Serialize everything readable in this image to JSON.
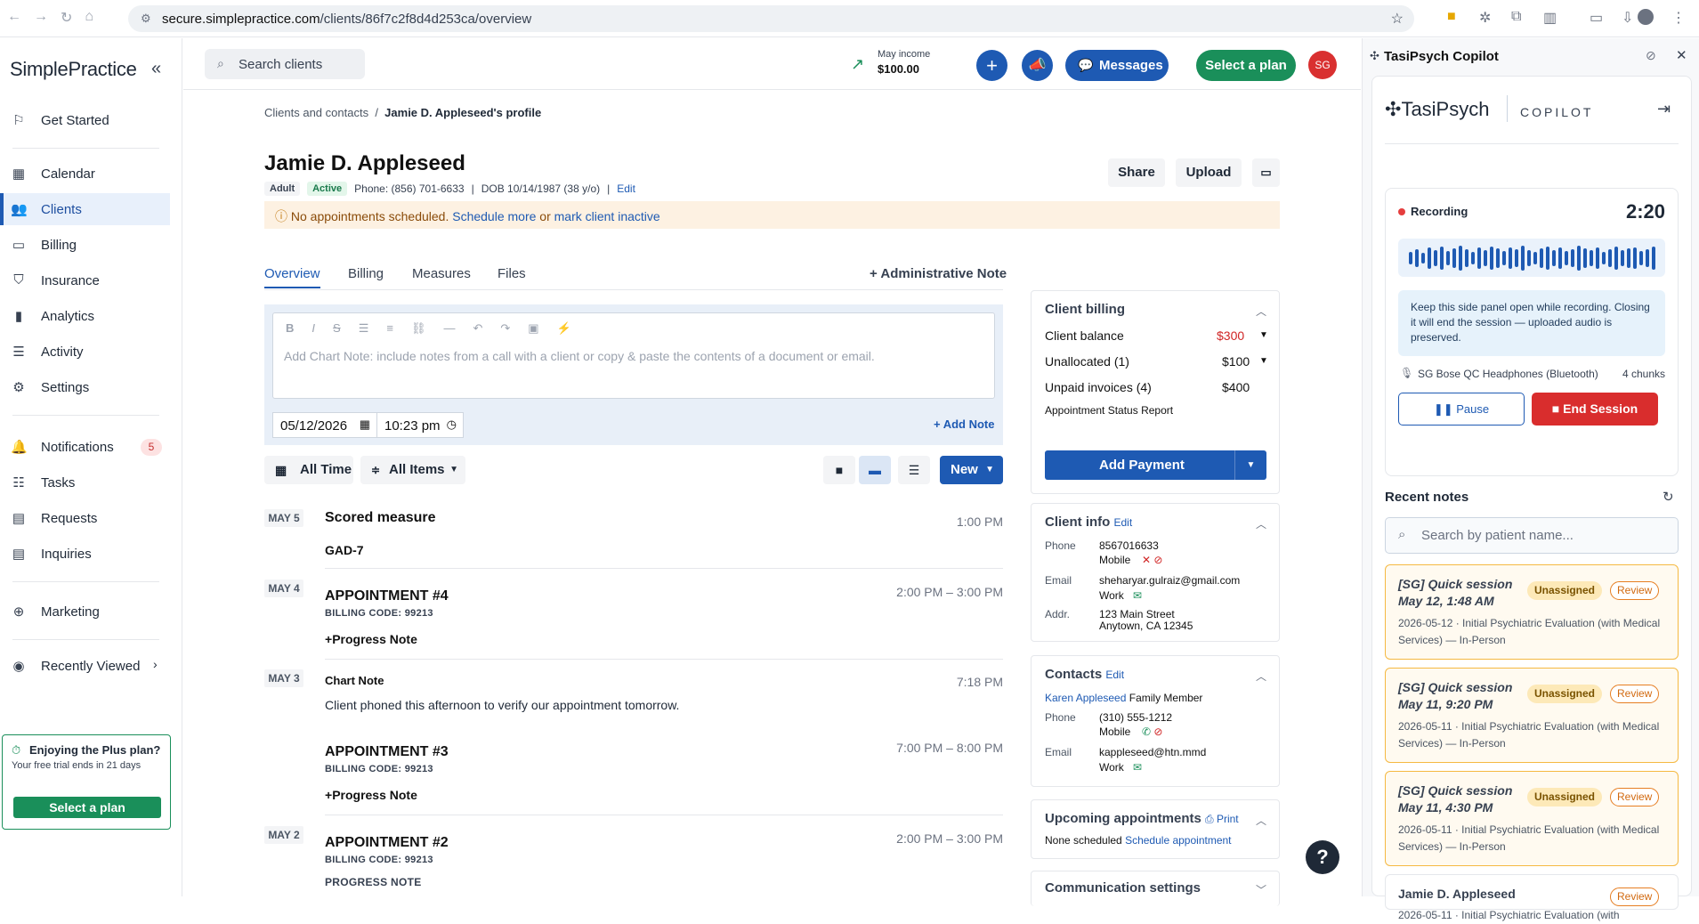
{
  "browser": {
    "url_host": "secure.simplepractice.com",
    "url_path": "/clients/86f7c2f8d4d253ca/overview"
  },
  "sidebar": {
    "logo": "SimplePractice",
    "items": [
      "Get Started",
      "Calendar",
      "Clients",
      "Billing",
      "Insurance",
      "Analytics",
      "Activity",
      "Settings",
      "Notifications",
      "Tasks",
      "Requests",
      "Inquiries",
      "Marketing",
      "Recently Viewed"
    ],
    "notif_count": "5",
    "promo_title": "Enjoying the Plus plan?",
    "promo_text": "Your free trial ends in 21 days",
    "promo_button": "Select a plan"
  },
  "topbar": {
    "search_placeholder": "Search clients",
    "income_label": "May income",
    "income_value": "$100.00",
    "messages": "Messages",
    "select_plan": "Select a plan",
    "avatar": "SG"
  },
  "breadcrumb": {
    "parent": "Clients and contacts",
    "sep": "/",
    "current": "Jamie D. Appleseed's profile"
  },
  "client": {
    "name": "Jamie D. Appleseed",
    "tag_adult": "Adult",
    "tag_active": "Active",
    "phone": "Phone: (856) 701-6633",
    "dob": "DOB 10/14/1987 (38 y/o)",
    "edit": "Edit",
    "share": "Share",
    "upload": "Upload"
  },
  "alert": {
    "text": "No appointments scheduled.",
    "link1": "Schedule more",
    "or": "or",
    "link2": "mark client inactive"
  },
  "tabs": [
    "Overview",
    "Billing",
    "Measures",
    "Files"
  ],
  "admin_note": "+ Administrative Note",
  "editor": {
    "placeholder": "Add Chart Note: include notes from a call with a client or copy & paste the contents of a document or email.",
    "date": "05/12/2026",
    "time": "10:23 pm",
    "add_note": "+ Add Note"
  },
  "filters": {
    "time": "All Time",
    "items": "All Items",
    "new": "New"
  },
  "timeline": [
    {
      "date": "MAY 5",
      "title": "Scored measure",
      "time": "1:00 PM",
      "link": "GAD-7"
    },
    {
      "date": "MAY 4",
      "title": "APPOINTMENT #4",
      "code": "BILLING CODE: 99213",
      "time": "2:00 PM – 3:00 PM",
      "link": "Progress Note"
    },
    {
      "date": "MAY 3",
      "title": "Chart Note",
      "time": "7:18 PM",
      "body": "Client phoned this afternoon to verify our appointment tomorrow."
    },
    {
      "title": "APPOINTMENT #3",
      "code": "BILLING CODE: 99213",
      "time": "7:00 PM – 8:00 PM",
      "link": "Progress Note"
    },
    {
      "date": "MAY 2",
      "title": "APPOINTMENT #2",
      "code": "BILLING CODE: 99213",
      "time": "2:00 PM – 3:00 PM",
      "sub": "PROGRESS NOTE"
    }
  ],
  "billing": {
    "title": "Client billing",
    "balance_label": "Client balance",
    "balance": "$300",
    "unalloc_label": "Unallocated (1)",
    "unalloc": "$100",
    "unpaid_label": "Unpaid invoices (4)",
    "unpaid": "$400",
    "report": "Appointment Status Report",
    "add_payment": "Add Payment"
  },
  "client_info": {
    "title": "Client info",
    "edit": "Edit",
    "phone_label": "Phone",
    "phone": "8567016633",
    "phone_type": "Mobile",
    "email_label": "Email",
    "email": "sheharyar.gulraiz@gmail.com",
    "email_type": "Work",
    "addr_label": "Addr.",
    "addr1": "123 Main Street",
    "addr2": "Anytown, CA 12345"
  },
  "contacts": {
    "title": "Contacts",
    "edit": "Edit",
    "name": "Karen Appleseed",
    "relation": "Family Member",
    "phone_label": "Phone",
    "phone": "(310) 555-1212",
    "phone_type": "Mobile",
    "email_label": "Email",
    "email": "kappleseed@htn.mmd",
    "email_type": "Work"
  },
  "upcoming": {
    "title": "Upcoming appointments",
    "print": "Print",
    "none": "None scheduled",
    "link": "Schedule appointment"
  },
  "comm": {
    "title": "Communication settings"
  },
  "copilot": {
    "panel_title": "TasiPsych Copilot",
    "brand": "TasiPsych",
    "brand_sub": "COPILOT",
    "recording": "Recording",
    "timer": "2:20",
    "info": "Keep this side panel open while recording. Closing it will end the session — uploaded audio is preserved.",
    "device": "SG Bose QC Headphones (Bluetooth)",
    "chunks": "4 chunks",
    "pause": "Pause",
    "end": "End Session",
    "recent": "Recent notes",
    "search_placeholder": "Search by patient name...",
    "notes": [
      {
        "title": "[SG] Quick session May 12, 1:48 AM",
        "status": "Unassigned",
        "action": "Review",
        "desc": "2026-05-12 · Initial Psychiatric Evaluation (with Medical Services) — In-Person"
      },
      {
        "title": "[SG] Quick session May 11, 9:20 PM",
        "status": "Unassigned",
        "action": "Review",
        "desc": "2026-05-11 · Initial Psychiatric Evaluation (with Medical Services) — In-Person"
      },
      {
        "title": "[SG] Quick session May 11, 4:30 PM",
        "status": "Unassigned",
        "action": "Review",
        "desc": "2026-05-11 · Initial Psychiatric Evaluation (with Medical Services) — In-Person"
      },
      {
        "title": "Jamie D. Appleseed",
        "action": "Review",
        "desc": "2026-05-11 · Initial Psychiatric Evaluation (with"
      }
    ]
  }
}
